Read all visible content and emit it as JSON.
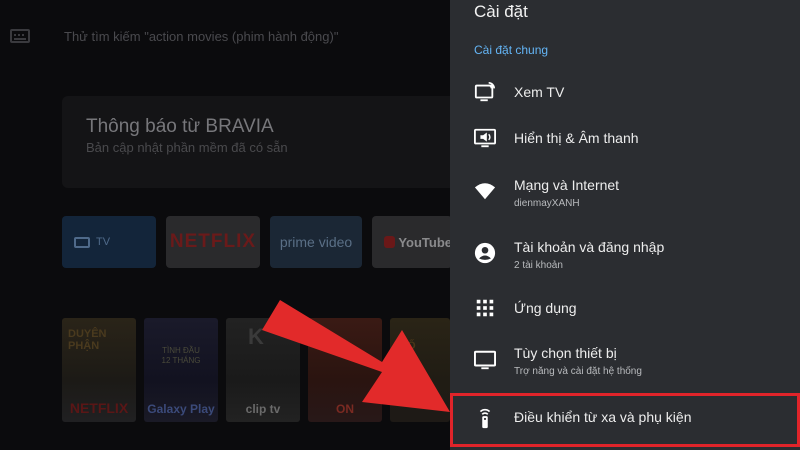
{
  "home": {
    "search_text": "Thử tìm kiếm \"action movies (phim hành động)\"",
    "notification": {
      "title": "Thông báo từ BRAVIA",
      "subtitle": "Bản cập nhật phần mềm đã có sẵn"
    },
    "apps": [
      {
        "label": "TV"
      },
      {
        "label": "NETFLIX"
      },
      {
        "label": "prime video"
      },
      {
        "label": "YouTube"
      }
    ],
    "posters": [
      {
        "art": "DUYÊN\nPHẬN",
        "label": "NETFLIX"
      },
      {
        "art": "TÌNH ĐẦU\n12 THÁNG",
        "label": "Galaxy Play"
      },
      {
        "art": "K",
        "label": "clip tv"
      },
      {
        "art": "",
        "label": "ON"
      },
      {
        "art": "MỐ",
        "label": ""
      }
    ]
  },
  "settings": {
    "title": "Cài đặt",
    "section_label": "Cài đặt chung",
    "items": [
      {
        "icon": "tv-signal-icon",
        "title": "Xem TV",
        "subtitle": ""
      },
      {
        "icon": "display-sound-icon",
        "title": "Hiển thị & Âm thanh",
        "subtitle": ""
      },
      {
        "icon": "wifi-icon",
        "title": "Mạng và Internet",
        "subtitle": "dienmayXANH"
      },
      {
        "icon": "account-icon",
        "title": "Tài khoản và đăng nhập",
        "subtitle": "2 tài khoản"
      },
      {
        "icon": "apps-grid-icon",
        "title": "Ứng dụng",
        "subtitle": ""
      },
      {
        "icon": "monitor-icon",
        "title": "Tùy chọn thiết bị",
        "subtitle": "Trợ năng và cài đặt hệ thống"
      },
      {
        "icon": "remote-icon",
        "title": "Điều khiển từ xa và phụ kiện",
        "subtitle": ""
      }
    ]
  },
  "colors": {
    "panel_bg": "#2b2d31",
    "accent_blue": "#64b5f6",
    "highlight_red": "#e0242a",
    "arrow_red": "#e22a2a"
  }
}
